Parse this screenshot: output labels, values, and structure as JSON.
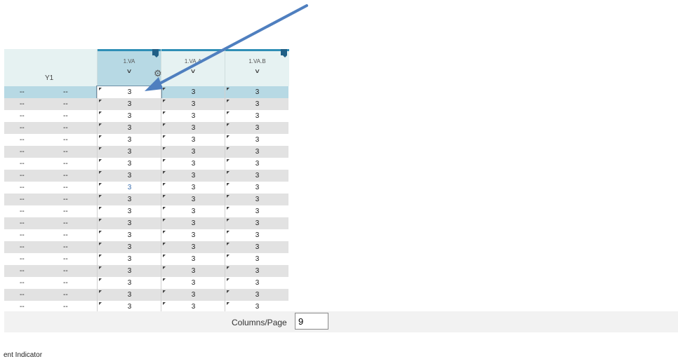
{
  "grid": {
    "left_header": {
      "label": "Y1"
    },
    "columns": [
      {
        "name": "1.VA",
        "selected": true
      },
      {
        "name": "1.VA.A",
        "selected": false
      },
      {
        "name": "1.VA.B",
        "selected": false
      }
    ],
    "rows": [
      {
        "c1": "--",
        "c2": "--",
        "v": [
          "3",
          "3",
          "3"
        ]
      },
      {
        "c1": "--",
        "c2": "--",
        "v": [
          "3",
          "3",
          "3"
        ]
      },
      {
        "c1": "--",
        "c2": "--",
        "v": [
          "3",
          "3",
          "3"
        ]
      },
      {
        "c1": "--",
        "c2": "--",
        "v": [
          "3",
          "3",
          "3"
        ]
      },
      {
        "c1": "--",
        "c2": "--",
        "v": [
          "3",
          "3",
          "3"
        ]
      },
      {
        "c1": "--",
        "c2": "--",
        "v": [
          "3",
          "3",
          "3"
        ]
      },
      {
        "c1": "--",
        "c2": "--",
        "v": [
          "3",
          "3",
          "3"
        ]
      },
      {
        "c1": "--",
        "c2": "--",
        "v": [
          "3",
          "3",
          "3"
        ]
      },
      {
        "c1": "--",
        "c2": "--",
        "v": [
          "3",
          "3",
          "3"
        ]
      },
      {
        "c1": "--",
        "c2": "--",
        "v": [
          "3",
          "3",
          "3"
        ]
      },
      {
        "c1": "--",
        "c2": "--",
        "v": [
          "3",
          "3",
          "3"
        ]
      },
      {
        "c1": "--",
        "c2": "--",
        "v": [
          "3",
          "3",
          "3"
        ]
      },
      {
        "c1": "--",
        "c2": "--",
        "v": [
          "3",
          "3",
          "3"
        ]
      },
      {
        "c1": "--",
        "c2": "--",
        "v": [
          "3",
          "3",
          "3"
        ]
      },
      {
        "c1": "--",
        "c2": "--",
        "v": [
          "3",
          "3",
          "3"
        ]
      },
      {
        "c1": "--",
        "c2": "--",
        "v": [
          "3",
          "3",
          "3"
        ]
      },
      {
        "c1": "--",
        "c2": "--",
        "v": [
          "3",
          "3",
          "3"
        ]
      },
      {
        "c1": "--",
        "c2": "--",
        "v": [
          "3",
          "3",
          "3"
        ]
      },
      {
        "c1": "--",
        "c2": "--",
        "v": [
          "3",
          "3",
          "3"
        ]
      }
    ]
  },
  "footer": {
    "columns_per_page_label": "Columns/Page",
    "columns_per_page_value": "9"
  },
  "status_text": "ent Indicator",
  "colors": {
    "header_bg": "#e6f2f2",
    "selected": "#b7d9e4",
    "accent": "#2f8fb6",
    "arrow": "#4f7fbf"
  },
  "icons": {
    "chevron": "chevron-down-icon",
    "gear": "gear-icon",
    "flag": "flag-icon",
    "arrow": "annotation-arrow-icon"
  }
}
